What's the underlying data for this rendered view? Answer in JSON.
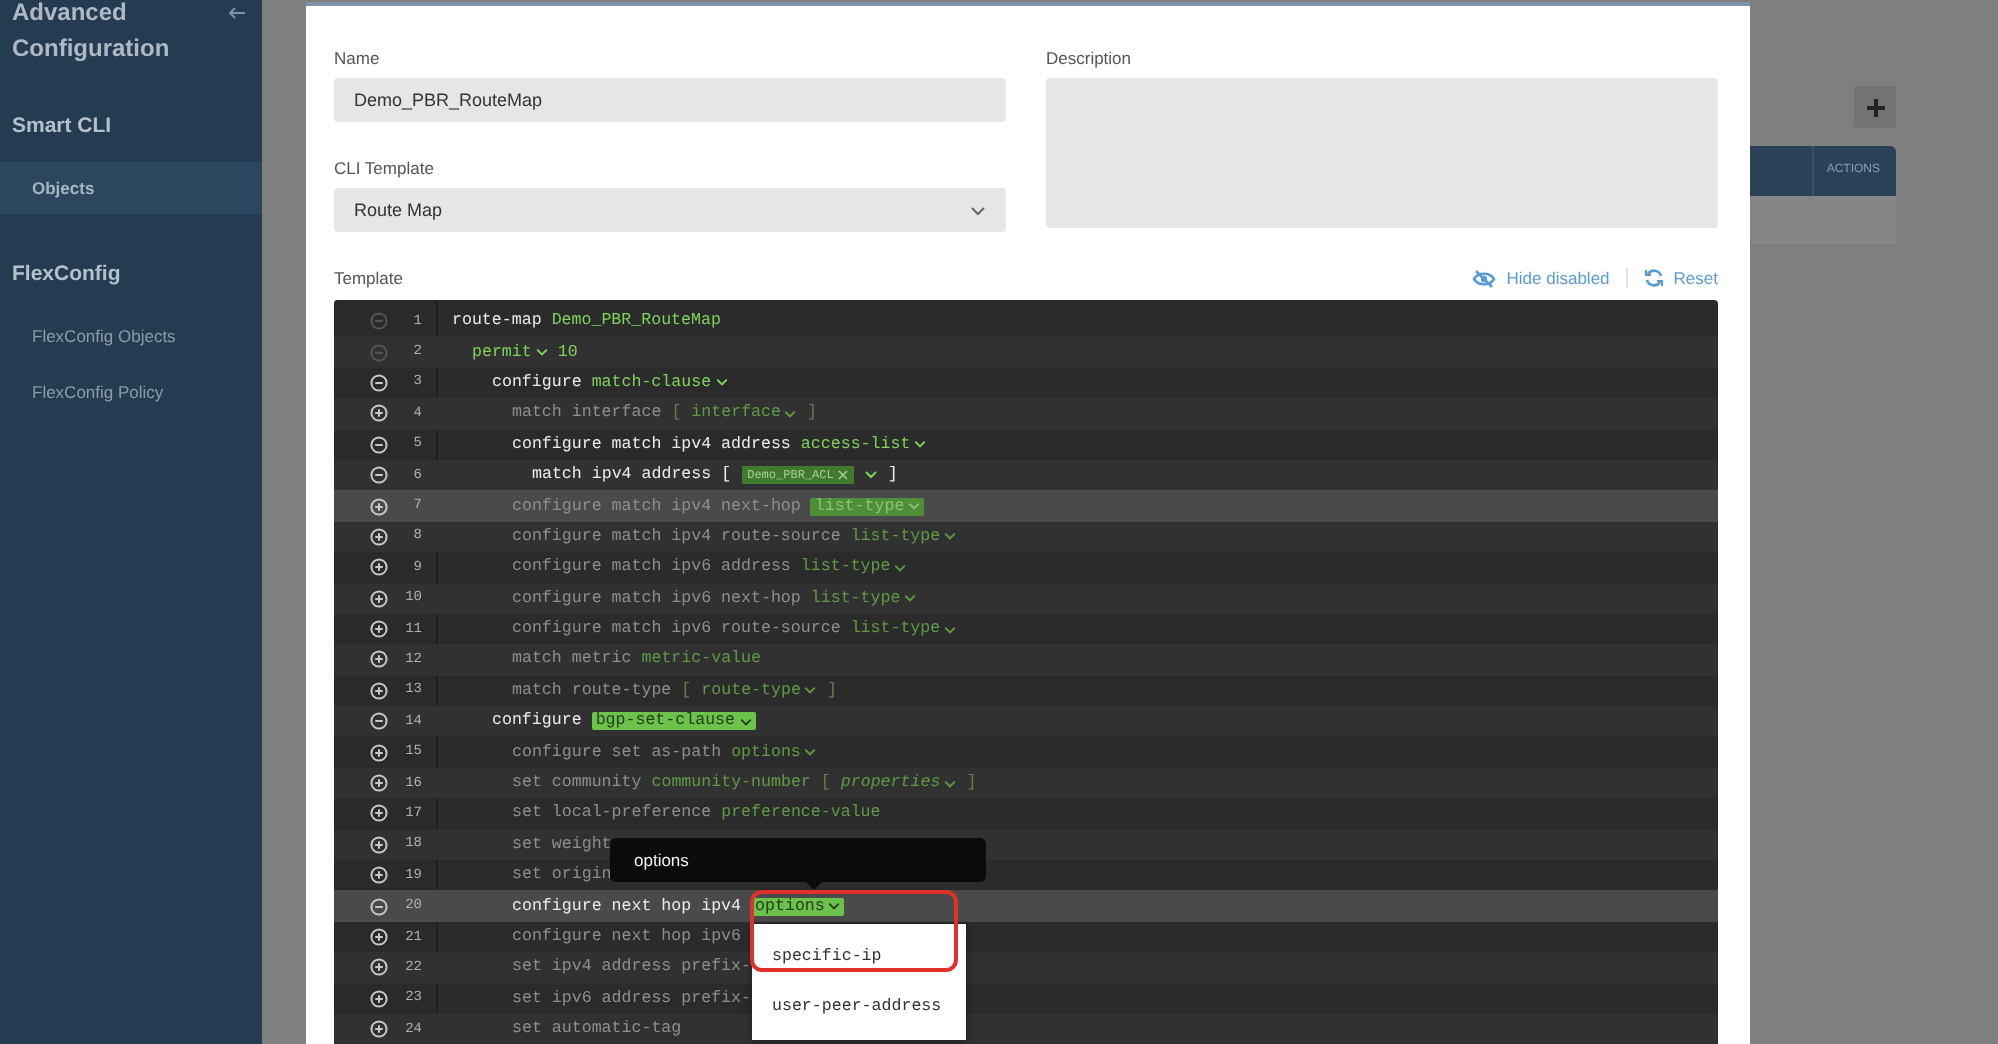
{
  "sidebar": {
    "title": "Advanced Configuration",
    "sections": [
      {
        "heading": "Smart CLI",
        "items": [
          {
            "label": "Objects",
            "selected": true
          }
        ]
      },
      {
        "heading": "FlexConfig",
        "items": [
          {
            "label": "FlexConfig Objects",
            "selected": false
          },
          {
            "label": "FlexConfig Policy",
            "selected": false
          }
        ]
      }
    ]
  },
  "background_table": {
    "columns": [
      "ACTIONS"
    ]
  },
  "form": {
    "name": {
      "label": "Name",
      "value": "Demo_PBR_RouteMap"
    },
    "template": {
      "label": "CLI Template",
      "value": "Route Map"
    },
    "description": {
      "label": "Description"
    }
  },
  "editor": {
    "label": "Template",
    "actions": [
      {
        "label": "Hide disabled",
        "kind": "hide"
      },
      {
        "label": "Reset",
        "kind": "reset"
      }
    ],
    "lines": [
      {
        "number": "1",
        "expanded": true,
        "locked": true,
        "enabled": true,
        "highlighted": false,
        "tokens": [
          {
            "kind": "keyword",
            "text": "route-map"
          },
          {
            "kind": "value",
            "text": "Demo_PBR_RouteMap"
          }
        ],
        "children": [
          {
            "number": "2",
            "expanded": true,
            "locked": true,
            "enabled": true,
            "highlighted": false,
            "tokens": [
              {
                "kind": "dropdown",
                "text": "permit"
              },
              {
                "kind": "value",
                "text": "10"
              }
            ],
            "children": [
              {
                "number": "3",
                "expanded": true,
                "locked": false,
                "enabled": true,
                "highlighted": false,
                "tokens": [
                  {
                    "kind": "keyword",
                    "text": "configure"
                  },
                  {
                    "kind": "dropdown",
                    "text": "match-clause"
                  }
                ],
                "children": [
                  {
                    "number": "4",
                    "expanded": false,
                    "locked": false,
                    "enabled": false,
                    "highlighted": false,
                    "tokens": [
                      {
                        "kind": "keyword",
                        "text": "match interface"
                      },
                      {
                        "kind": "bracket",
                        "text": "["
                      },
                      {
                        "kind": "dropdown",
                        "text": "interface"
                      },
                      {
                        "kind": "bracket",
                        "text": "]"
                      }
                    ]
                  },
                  {
                    "number": "5",
                    "expanded": true,
                    "locked": false,
                    "enabled": true,
                    "highlighted": false,
                    "tokens": [
                      {
                        "kind": "keyword",
                        "text": "configure match ipv4 address"
                      },
                      {
                        "kind": "dropdown",
                        "text": "access-list"
                      }
                    ],
                    "children": [
                      {
                        "number": "6",
                        "expanded": true,
                        "locked": false,
                        "enabled": true,
                        "highlighted": false,
                        "tokens": [
                          {
                            "kind": "keyword",
                            "text": "match ipv4 address"
                          },
                          {
                            "kind": "bracket",
                            "text": "["
                          },
                          {
                            "kind": "tag",
                            "text": "Demo_PBR_ACL"
                          },
                          {
                            "kind": "caret"
                          },
                          {
                            "kind": "bracket",
                            "text": "]"
                          }
                        ]
                      }
                    ]
                  },
                  {
                    "number": "7",
                    "expanded": false,
                    "locked": false,
                    "enabled": false,
                    "highlighted": true,
                    "tokens": [
                      {
                        "kind": "keyword",
                        "text": "configure match ipv4 next-hop"
                      },
                      {
                        "kind": "dropdown_active",
                        "text": "list-type"
                      }
                    ]
                  },
                  {
                    "number": "8",
                    "expanded": false,
                    "locked": false,
                    "enabled": false,
                    "highlighted": false,
                    "tokens": [
                      {
                        "kind": "keyword",
                        "text": "configure match ipv4 route-source"
                      },
                      {
                        "kind": "dropdown",
                        "text": "list-type"
                      }
                    ]
                  },
                  {
                    "number": "9",
                    "expanded": false,
                    "locked": false,
                    "enabled": false,
                    "highlighted": false,
                    "tokens": [
                      {
                        "kind": "keyword",
                        "text": "configure match ipv6 address"
                      },
                      {
                        "kind": "dropdown",
                        "text": "list-type"
                      }
                    ]
                  },
                  {
                    "number": "10",
                    "expanded": false,
                    "locked": false,
                    "enabled": false,
                    "highlighted": false,
                    "tokens": [
                      {
                        "kind": "keyword",
                        "text": "configure match ipv6 next-hop"
                      },
                      {
                        "kind": "dropdown",
                        "text": "list-type"
                      }
                    ]
                  },
                  {
                    "number": "11",
                    "expanded": false,
                    "locked": false,
                    "enabled": false,
                    "highlighted": false,
                    "tokens": [
                      {
                        "kind": "keyword",
                        "text": "configure match ipv6 route-source"
                      },
                      {
                        "kind": "dropdown",
                        "text": "list-type"
                      }
                    ]
                  },
                  {
                    "number": "12",
                    "expanded": false,
                    "locked": false,
                    "enabled": false,
                    "highlighted": false,
                    "tokens": [
                      {
                        "kind": "keyword",
                        "text": "match metric"
                      },
                      {
                        "kind": "value",
                        "text": "metric-value"
                      }
                    ]
                  },
                  {
                    "number": "13",
                    "expanded": false,
                    "locked": false,
                    "enabled": false,
                    "highlighted": false,
                    "tokens": [
                      {
                        "kind": "keyword",
                        "text": "match route-type"
                      },
                      {
                        "kind": "bracket",
                        "text": "["
                      },
                      {
                        "kind": "dropdown",
                        "text": "route-type"
                      },
                      {
                        "kind": "bracket",
                        "text": "]"
                      }
                    ]
                  }
                ]
              },
              {
                "number": "14",
                "expanded": true,
                "locked": false,
                "enabled": true,
                "highlighted": false,
                "tokens": [
                  {
                    "kind": "keyword",
                    "text": "configure"
                  },
                  {
                    "kind": "dropdown_active",
                    "text": "bgp-set-clause"
                  }
                ],
                "children": [
                  {
                    "number": "15",
                    "expanded": false,
                    "locked": false,
                    "enabled": false,
                    "highlighted": false,
                    "tokens": [
                      {
                        "kind": "keyword",
                        "text": "configure set as-path"
                      },
                      {
                        "kind": "dropdown",
                        "text": "options"
                      }
                    ]
                  },
                  {
                    "number": "16",
                    "expanded": false,
                    "locked": false,
                    "enabled": false,
                    "highlighted": false,
                    "tokens": [
                      {
                        "kind": "keyword",
                        "text": "set community"
                      },
                      {
                        "kind": "value",
                        "text": "community-number"
                      },
                      {
                        "kind": "bracket",
                        "text": "["
                      },
                      {
                        "kind": "dropdown_italic",
                        "text": "properties"
                      },
                      {
                        "kind": "bracket",
                        "text": "]"
                      }
                    ]
                  },
                  {
                    "number": "17",
                    "expanded": false,
                    "locked": false,
                    "enabled": false,
                    "highlighted": false,
                    "tokens": [
                      {
                        "kind": "keyword",
                        "text": "set local-preference"
                      },
                      {
                        "kind": "value",
                        "text": "preference-value"
                      }
                    ]
                  },
                  {
                    "number": "18",
                    "expanded": false,
                    "locked": false,
                    "enabled": false,
                    "highlighted": false,
                    "tokens": [
                      {
                        "kind": "keyword",
                        "text": "set weight"
                      }
                    ]
                  },
                  {
                    "number": "19",
                    "expanded": false,
                    "locked": false,
                    "enabled": false,
                    "highlighted": false,
                    "tokens": [
                      {
                        "kind": "keyword",
                        "text": "set origin"
                      }
                    ]
                  },
                  {
                    "number": "20",
                    "expanded": true,
                    "locked": false,
                    "enabled": true,
                    "highlighted": true,
                    "tokens": [
                      {
                        "kind": "keyword",
                        "text": "configure next hop ipv4"
                      },
                      {
                        "kind": "dropdown_active",
                        "text": "options"
                      }
                    ]
                  },
                  {
                    "number": "21",
                    "expanded": false,
                    "locked": false,
                    "enabled": false,
                    "highlighted": false,
                    "tokens": [
                      {
                        "kind": "keyword",
                        "text": "configure next hop ipv6"
                      }
                    ]
                  },
                  {
                    "number": "22",
                    "expanded": false,
                    "locked": false,
                    "enabled": false,
                    "highlighted": false,
                    "tokens": [
                      {
                        "kind": "keyword",
                        "text": "set ipv4 address prefix-"
                      }
                    ]
                  },
                  {
                    "number": "23",
                    "expanded": false,
                    "locked": false,
                    "enabled": false,
                    "highlighted": false,
                    "tokens": [
                      {
                        "kind": "keyword",
                        "text": "set ipv6 address prefix-"
                      }
                    ]
                  },
                  {
                    "number": "24",
                    "expanded": false,
                    "locked": false,
                    "enabled": false,
                    "highlighted": false,
                    "tokens": [
                      {
                        "kind": "keyword",
                        "text": "set automatic-tag"
                      }
                    ]
                  }
                ]
              }
            ]
          }
        ]
      }
    ],
    "tooltip": "options",
    "menu": {
      "annotated": true,
      "items": [
        {
          "label": "specific-ip"
        },
        {
          "label": "user-peer-address"
        }
      ]
    }
  }
}
